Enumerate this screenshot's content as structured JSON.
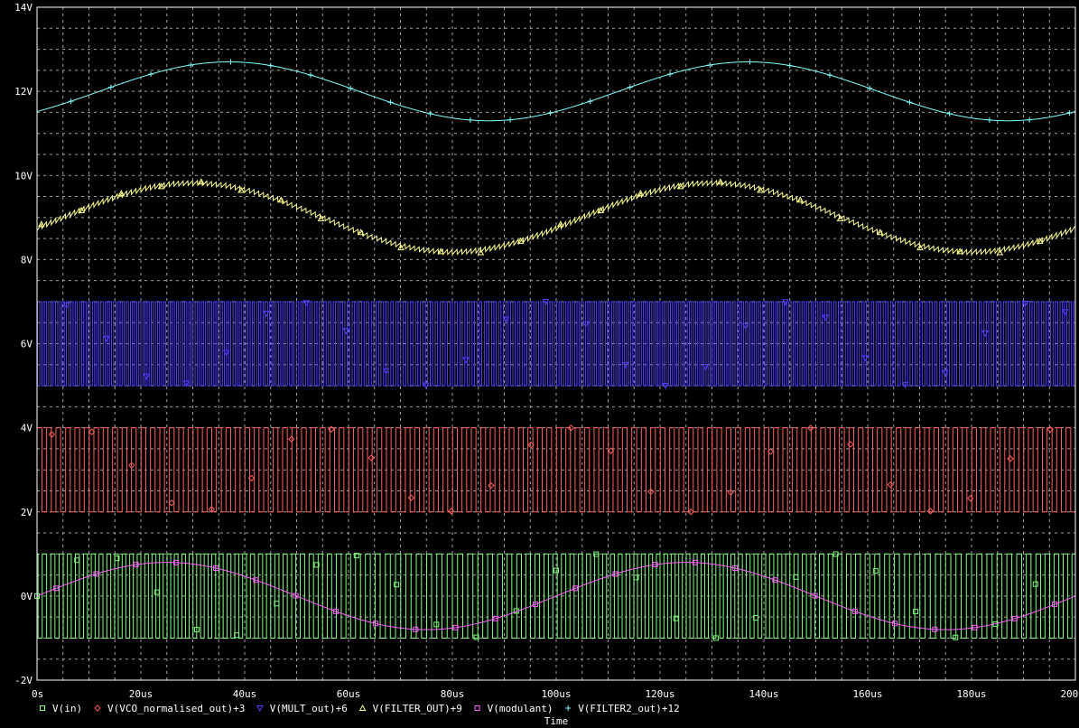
{
  "chart_data": {
    "type": "line",
    "xlabel": "Time",
    "x_range": [
      0,
      200
    ],
    "x_unit": "us",
    "y_range": [
      -2,
      14
    ],
    "y_unit": "V",
    "grid": true,
    "legend_placement": "bottom",
    "x_ticks": [
      {
        "value": 0,
        "label": "0s"
      },
      {
        "value": 20,
        "label": "20us"
      },
      {
        "value": 40,
        "label": "40us"
      },
      {
        "value": 60,
        "label": "60us"
      },
      {
        "value": 80,
        "label": "80us"
      },
      {
        "value": 100,
        "label": "100us"
      },
      {
        "value": 120,
        "label": "120us"
      },
      {
        "value": 140,
        "label": "140us"
      },
      {
        "value": 160,
        "label": "160us"
      },
      {
        "value": 180,
        "label": "180us"
      },
      {
        "value": 200,
        "label": "200us"
      }
    ],
    "y_ticks": [
      {
        "value": -2,
        "label": "-2V"
      },
      {
        "value": 0,
        "label": "0V"
      },
      {
        "value": 2,
        "label": "2V"
      },
      {
        "value": 4,
        "label": "4V"
      },
      {
        "value": 6,
        "label": "6V"
      },
      {
        "value": 8,
        "label": "8V"
      },
      {
        "value": 10,
        "label": "10V"
      },
      {
        "value": 12,
        "label": "12V"
      },
      {
        "value": 14,
        "label": "14V"
      }
    ],
    "series": [
      {
        "name": "V(in)",
        "color": "#80ff80",
        "marker": "square",
        "kind": "square_wave",
        "low": -1,
        "high": 1,
        "offset": 0,
        "carrier_khz": 600,
        "dev_khz": 100,
        "mod_khz": 10
      },
      {
        "name": "V(VCO_normalised_out)+3",
        "color": "#ff6060",
        "marker": "diamond",
        "kind": "square_wave",
        "low": 2,
        "high": 4,
        "offset": 3,
        "carrier_khz": 550,
        "dev_khz": 0,
        "mod_khz": 10
      },
      {
        "name": "V(MULT_out)+6",
        "color": "#5040ff",
        "marker": "triangle-down",
        "kind": "square_wave",
        "low": 5,
        "high": 7,
        "offset": 6,
        "carrier_khz": 1150,
        "dev_khz": 100,
        "mod_khz": 10
      },
      {
        "name": "V(FILTER_OUT)+9",
        "color": "#ffff90",
        "marker": "triangle",
        "kind": "sine_ripple",
        "offset": 9,
        "amplitude": 0.82,
        "mod_khz": 10,
        "phase_us": 5,
        "ripple": 0.12
      },
      {
        "name": "V(modulant)",
        "color": "#ff60ff",
        "marker": "square",
        "kind": "sine",
        "offset": 0,
        "amplitude": 0.8,
        "mod_khz": 10,
        "phase_us": 0
      },
      {
        "name": "V(FILTER2_out)+12",
        "color": "#80ffff",
        "marker": "plus",
        "kind": "sine",
        "offset": 12,
        "amplitude": 0.7,
        "mod_khz": 10,
        "phase_us": 12
      }
    ]
  }
}
